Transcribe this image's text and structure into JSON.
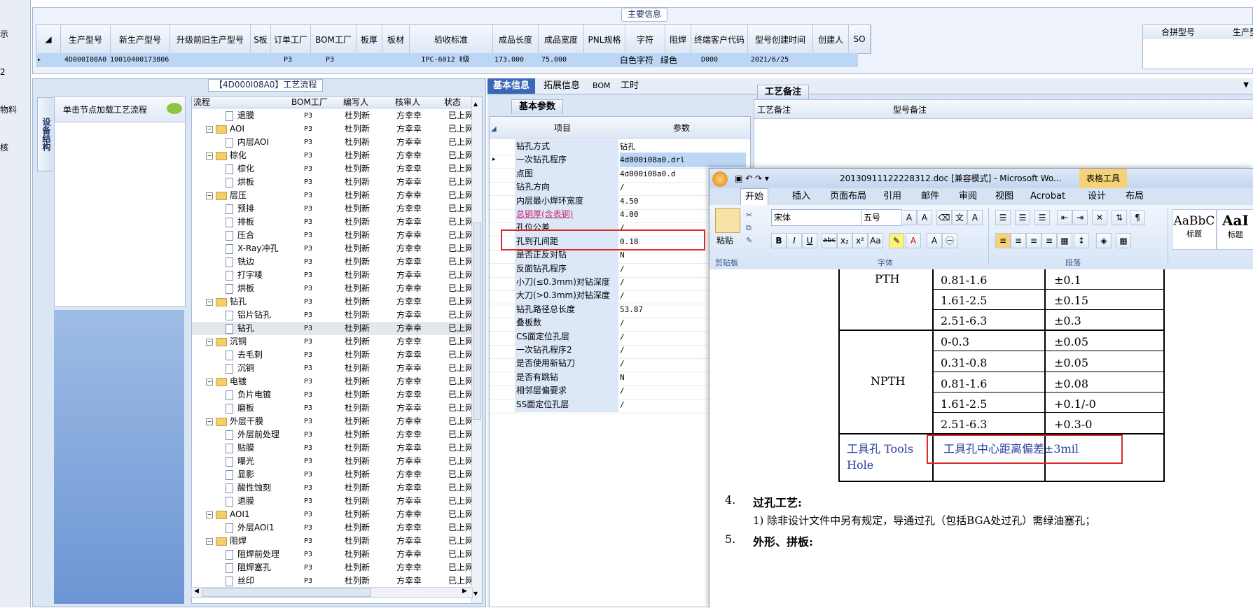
{
  "left_strip": [
    "示",
    "2",
    "物料",
    "核"
  ],
  "main_info": {
    "title": "主要信息",
    "columns": [
      "生产型号",
      "新生产型号",
      "升级前旧生产型号",
      "S板",
      "订单工厂",
      "BOM工厂",
      "板厚",
      "板材",
      "验收标准",
      "成品长度",
      "成品宽度",
      "PNL规格",
      "字符",
      "阻焊",
      "终端客户代码",
      "型号创建时间",
      "创建人",
      "SO"
    ],
    "row": {
      "marker": "▸",
      "cells": [
        "4D000I08A0",
        "10010400173806",
        "",
        "",
        "P3",
        "P3",
        "",
        "",
        "IPC-6012 Ⅱ级",
        "173.000",
        "75.000",
        "",
        "白色字符",
        "绿色",
        "D000",
        "2021/6/25",
        "",
        ""
      ]
    },
    "right_columns": [
      "合拼型号",
      "生产型号"
    ]
  },
  "process": {
    "title": "【4D000I08A0】工艺流程",
    "vertical_tab": "设备结构",
    "hint": "单击节点加载工艺流程",
    "headers": [
      "流程",
      "BOM工厂",
      "编写人",
      "核审人",
      "状态"
    ],
    "rows": [
      {
        "name": "退膜",
        "level": 2,
        "bom": "P3",
        "editor": "杜列新",
        "reviewer": "方幸幸",
        "status": "已上网"
      },
      {
        "name": "AOI",
        "level": 1,
        "bom": "P3",
        "editor": "杜列新",
        "reviewer": "方幸幸",
        "status": "已上网"
      },
      {
        "name": "内层AOI",
        "level": 2,
        "bom": "P3",
        "editor": "杜列新",
        "reviewer": "方幸幸",
        "status": "已上网"
      },
      {
        "name": "棕化",
        "level": 1,
        "bom": "P3",
        "editor": "杜列新",
        "reviewer": "方幸幸",
        "status": "已上网"
      },
      {
        "name": "棕化",
        "level": 2,
        "bom": "P3",
        "editor": "杜列新",
        "reviewer": "方幸幸",
        "status": "已上网"
      },
      {
        "name": "烘板",
        "level": 2,
        "bom": "P3",
        "editor": "杜列新",
        "reviewer": "方幸幸",
        "status": "已上网"
      },
      {
        "name": "层压",
        "level": 1,
        "bom": "P3",
        "editor": "杜列新",
        "reviewer": "方幸幸",
        "status": "已上网"
      },
      {
        "name": "预排",
        "level": 2,
        "bom": "P3",
        "editor": "杜列新",
        "reviewer": "方幸幸",
        "status": "已上网"
      },
      {
        "name": "排板",
        "level": 2,
        "bom": "P3",
        "editor": "杜列新",
        "reviewer": "方幸幸",
        "status": "已上网"
      },
      {
        "name": "压合",
        "level": 2,
        "bom": "P3",
        "editor": "杜列新",
        "reviewer": "方幸幸",
        "status": "已上网"
      },
      {
        "name": "X-Ray冲孔",
        "level": 2,
        "bom": "P3",
        "editor": "杜列新",
        "reviewer": "方幸幸",
        "status": "已上网"
      },
      {
        "name": "铣边",
        "level": 2,
        "bom": "P3",
        "editor": "杜列新",
        "reviewer": "方幸幸",
        "status": "已上网"
      },
      {
        "name": "打字唛",
        "level": 2,
        "bom": "P3",
        "editor": "杜列新",
        "reviewer": "方幸幸",
        "status": "已上网"
      },
      {
        "name": "烘板",
        "level": 2,
        "bom": "P3",
        "editor": "杜列新",
        "reviewer": "方幸幸",
        "status": "已上网"
      },
      {
        "name": "钻孔",
        "level": 1,
        "bom": "P3",
        "editor": "杜列新",
        "reviewer": "方幸幸",
        "status": "已上网"
      },
      {
        "name": "铝片钻孔",
        "level": 2,
        "bom": "P3",
        "editor": "杜列新",
        "reviewer": "方幸幸",
        "status": "已上网"
      },
      {
        "name": "钻孔",
        "level": 2,
        "bom": "P3",
        "editor": "杜列新",
        "reviewer": "方幸幸",
        "status": "已上网",
        "selected": true
      },
      {
        "name": "沉铜",
        "level": 1,
        "bom": "P3",
        "editor": "杜列新",
        "reviewer": "方幸幸",
        "status": "已上网"
      },
      {
        "name": "去毛刺",
        "level": 2,
        "bom": "P3",
        "editor": "杜列新",
        "reviewer": "方幸幸",
        "status": "已上网"
      },
      {
        "name": "沉铜",
        "level": 2,
        "bom": "P3",
        "editor": "杜列新",
        "reviewer": "方幸幸",
        "status": "已上网"
      },
      {
        "name": "电镀",
        "level": 1,
        "bom": "P3",
        "editor": "杜列新",
        "reviewer": "方幸幸",
        "status": "已上网"
      },
      {
        "name": "负片电镀",
        "level": 2,
        "bom": "P3",
        "editor": "杜列新",
        "reviewer": "方幸幸",
        "status": "已上网"
      },
      {
        "name": "磨板",
        "level": 2,
        "bom": "P3",
        "editor": "杜列新",
        "reviewer": "方幸幸",
        "status": "已上网"
      },
      {
        "name": "外层干膜",
        "level": 1,
        "bom": "P3",
        "editor": "杜列新",
        "reviewer": "方幸幸",
        "status": "已上网"
      },
      {
        "name": "外层前处理",
        "level": 2,
        "bom": "P3",
        "editor": "杜列新",
        "reviewer": "方幸幸",
        "status": "已上网"
      },
      {
        "name": "贴膜",
        "level": 2,
        "bom": "P3",
        "editor": "杜列新",
        "reviewer": "方幸幸",
        "status": "已上网"
      },
      {
        "name": "曝光",
        "level": 2,
        "bom": "P3",
        "editor": "杜列新",
        "reviewer": "方幸幸",
        "status": "已上网"
      },
      {
        "name": "显影",
        "level": 2,
        "bom": "P3",
        "editor": "杜列新",
        "reviewer": "方幸幸",
        "status": "已上网"
      },
      {
        "name": "酸性蚀刻",
        "level": 2,
        "bom": "P3",
        "editor": "杜列新",
        "reviewer": "方幸幸",
        "status": "已上网"
      },
      {
        "name": "退膜",
        "level": 2,
        "bom": "P3",
        "editor": "杜列新",
        "reviewer": "方幸幸",
        "status": "已上网"
      },
      {
        "name": "AOI1",
        "level": 1,
        "bom": "P3",
        "editor": "杜列新",
        "reviewer": "方幸幸",
        "status": "已上网"
      },
      {
        "name": "外层AOI1",
        "level": 2,
        "bom": "P3",
        "editor": "杜列新",
        "reviewer": "方幸幸",
        "status": "已上网"
      },
      {
        "name": "阻焊",
        "level": 1,
        "bom": "P3",
        "editor": "杜列新",
        "reviewer": "方幸幸",
        "status": "已上网"
      },
      {
        "name": "阻焊前处理",
        "level": 2,
        "bom": "P3",
        "editor": "杜列新",
        "reviewer": "方幸幸",
        "status": "已上网"
      },
      {
        "name": "阻焊塞孔",
        "level": 2,
        "bom": "P3",
        "editor": "杜列新",
        "reviewer": "方幸幸",
        "status": "已上网"
      },
      {
        "name": "丝印",
        "level": 2,
        "bom": "P3",
        "editor": "杜列新",
        "reviewer": "方幸幸",
        "status": "已上网"
      }
    ]
  },
  "basic": {
    "tabs": [
      "基本信息",
      "拓展信息",
      "BOM",
      "工时"
    ],
    "sub_tab": "基本参数",
    "notes_tab": "工艺备注",
    "headers": [
      "项目",
      "参数"
    ],
    "notes_headers": [
      "工艺备注",
      "型号备注"
    ],
    "rows": [
      {
        "k": "钻孔方式",
        "v": "钻孔"
      },
      {
        "k": "一次钻孔程序",
        "v": "4d000i08a0.drl",
        "selected": true
      },
      {
        "k": "点图",
        "v": "4d000i08a0.d"
      },
      {
        "k": "钻孔方向",
        "v": "/"
      },
      {
        "k": "内层最小焊环宽度",
        "v": "4.50"
      },
      {
        "k": "总铜厚(含表铜)",
        "v": "4.00",
        "highlight": true
      },
      {
        "k": "孔位公差",
        "v": "/",
        "boxed": true
      },
      {
        "k": "孔到孔间距",
        "v": "0.18"
      },
      {
        "k": "是否正反对钻",
        "v": "N"
      },
      {
        "k": "反面钻孔程序",
        "v": "/"
      },
      {
        "k": "小刀(≤0.3mm)对钻深度",
        "v": "/"
      },
      {
        "k": "大刀(>0.3mm)对钻深度",
        "v": "/"
      },
      {
        "k": "钻孔路径总长度",
        "v": "53.87"
      },
      {
        "k": "叠板数",
        "v": "/"
      },
      {
        "k": "CS面定位孔层",
        "v": "/"
      },
      {
        "k": "一次钻孔程序2",
        "v": "/"
      },
      {
        "k": "是否使用新钻刀",
        "v": "/"
      },
      {
        "k": "是否有跳钻",
        "v": "N"
      },
      {
        "k": "相邻层偏要求",
        "v": "/"
      },
      {
        "k": "SS面定位孔层",
        "v": "/"
      }
    ]
  },
  "word": {
    "title": "20130911122228312.doc [兼容模式] - Microsoft Wo...",
    "context_tab": "表格工具",
    "tabs": [
      "开始",
      "插入",
      "页面布局",
      "引用",
      "邮件",
      "审阅",
      "视图",
      "Acrobat",
      "设计",
      "布局"
    ],
    "font": "宋体",
    "size": "五号",
    "paste_label": "粘贴",
    "groups": [
      "剪贴板",
      "字体",
      "段落"
    ],
    "styles": [
      {
        "sample": "AaBbC",
        "name": "标题"
      },
      {
        "sample": "AaI",
        "name": "标题"
      }
    ],
    "table": {
      "pth_label": "PTH",
      "npth_label": "NPTH",
      "pth_rows": [
        [
          "0.81-1.6",
          "±0.1"
        ],
        [
          "1.61-2.5",
          "±0.15"
        ],
        [
          "2.51-6.3",
          "±0.3"
        ]
      ],
      "npth_rows": [
        [
          "0-0.3",
          "±0.05"
        ],
        [
          "0.31-0.8",
          "±0.05"
        ],
        [
          "0.81-1.6",
          "±0.08"
        ],
        [
          "1.61-2.5",
          "+0.1/-0"
        ],
        [
          "2.51-6.3",
          "+0.3-0"
        ]
      ],
      "tool_label_1": "工具孔 Tools",
      "tool_label_2": "Hole",
      "tool_value": "工具孔中心距离偏差±3mil"
    },
    "para4_num": "4.",
    "para4": "过孔工艺:",
    "para4_1": "1)  除非设计文件中另有规定，导通过孔（包括BGA处过孔）需绿油塞孔；",
    "para5_num": "5.",
    "para5": "外形、拼板:"
  }
}
